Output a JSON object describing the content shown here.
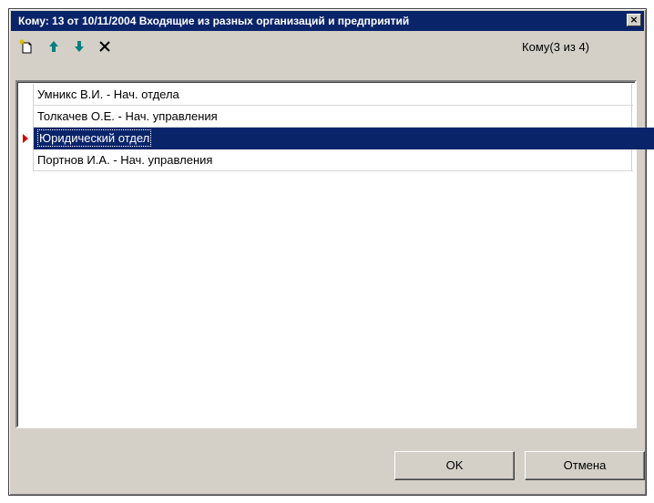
{
  "window": {
    "title": "Кому: 13 от 10/11/2004 Входящие из разных организаций и предприятий",
    "close_glyph": "×"
  },
  "toolbar": {
    "buttons": [
      {
        "icon": "new-item-icon"
      },
      {
        "icon": "arrow-up-icon"
      },
      {
        "icon": "arrow-down-icon"
      },
      {
        "icon": "delete-icon"
      }
    ],
    "counter": "Кому(3 из 4)"
  },
  "list": {
    "selected_index": 2,
    "rows": [
      {
        "text": "Умникс В.И. - Нач. отдела"
      },
      {
        "text": "Толкачев О.Е. - Нач. управления"
      },
      {
        "text": "Юридический отдел"
      },
      {
        "text": "Портнов И.А. - Нач. управления"
      }
    ]
  },
  "buttons": {
    "ok": "OK",
    "cancel": "Отмена"
  },
  "colors": {
    "title_bar": "#0a246a",
    "selection": "#0a246a",
    "window_face": "#d4d0c8",
    "up_arrow": "#008080",
    "down_arrow": "#008080",
    "row_marker": "#d00000"
  }
}
